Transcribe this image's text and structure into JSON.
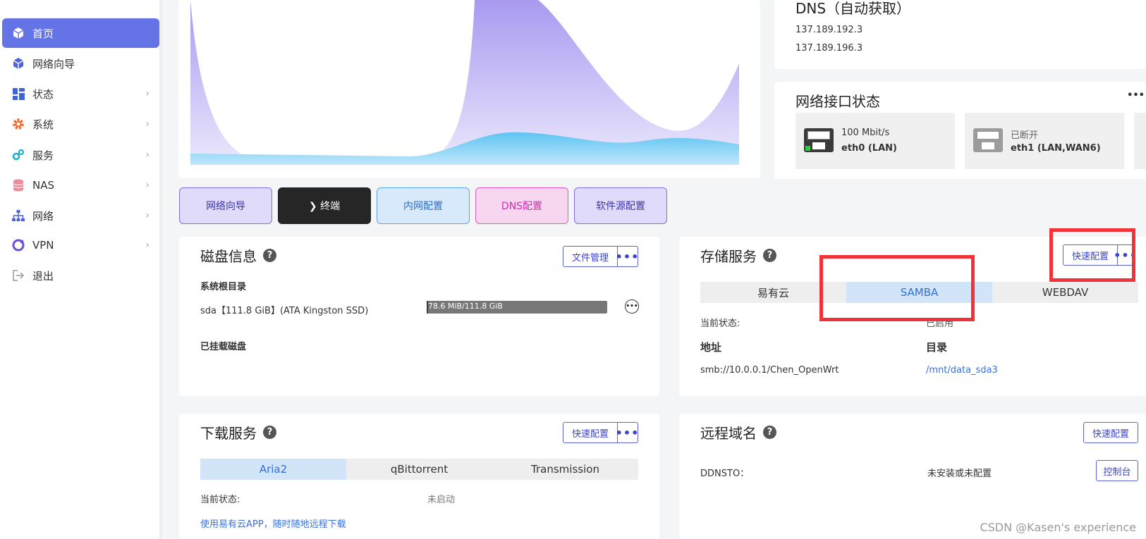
{
  "sidebar": {
    "items": [
      {
        "label": "首页",
        "icon": "cube-icon"
      },
      {
        "label": "网络向导",
        "icon": "cube-icon"
      },
      {
        "label": "状态",
        "icon": "dashboard-icon"
      },
      {
        "label": "系统",
        "icon": "gear-icon"
      },
      {
        "label": "服务",
        "icon": "gears-icon"
      },
      {
        "label": "NAS",
        "icon": "database-icon"
      },
      {
        "label": "网络",
        "icon": "sitemap-icon"
      },
      {
        "label": "VPN",
        "icon": "vpn-icon"
      },
      {
        "label": "退出",
        "icon": "logout-icon"
      }
    ]
  },
  "dns": {
    "title": "DNS（自动获取）",
    "servers": [
      "137.189.192.3",
      "137.189.196.3"
    ]
  },
  "interfaces": {
    "title": "网络接口状态",
    "items": [
      {
        "status": "100 Mbit/s",
        "name": "eth0 (LAN)"
      },
      {
        "status": "已断开",
        "name": "eth1 (LAN,WAN6)"
      }
    ]
  },
  "quick_buttons": [
    "网络向导",
    "❯ 终端",
    "内网配置",
    "DNS配置",
    "软件源配置"
  ],
  "disk": {
    "title": "磁盘信息",
    "file_button": "文件管理",
    "root_label": "系统根目录",
    "disk_name": "sda【111.8 GiB】(ATA Kingston SSD)",
    "usage_text": "78.6 MiB/111.8 GiB",
    "usage_fraction": 0.0007,
    "mounted_label": "已挂载磁盘"
  },
  "storage": {
    "title": "存储服务",
    "quick_button": "快速配置",
    "tabs": [
      "易有云",
      "SAMBA",
      "WEBDAV"
    ],
    "active_tab": 1,
    "status_label": "当前状态:",
    "status_value": "已启用",
    "addr_label": "地址",
    "dir_label": "目录",
    "addr_value": "smb://10.0.0.1/Chen_OpenWrt",
    "dir_value": "/mnt/data_sda3"
  },
  "download": {
    "title": "下载服务",
    "quick_button": "快速配置",
    "tabs": [
      "Aria2",
      "qBittorrent",
      "Transmission"
    ],
    "active_tab": 0,
    "status_label": "当前状态:",
    "status_value": "未启动",
    "link": "使用易有云APP，随时随地远程下载"
  },
  "remote": {
    "title": "远程域名",
    "quick_button": "快速配置",
    "ddnsto_label": "DDNSTO：",
    "ddnsto_status": "未安装或未配置",
    "console_button": "控制台"
  },
  "help_glyph": "?",
  "dots_glyph": "•••",
  "chevron_glyph": "›",
  "watermark": "CSDN @Kasen's experience",
  "colors": {
    "accent": "#6473e5",
    "highlight": "#ef3338"
  }
}
